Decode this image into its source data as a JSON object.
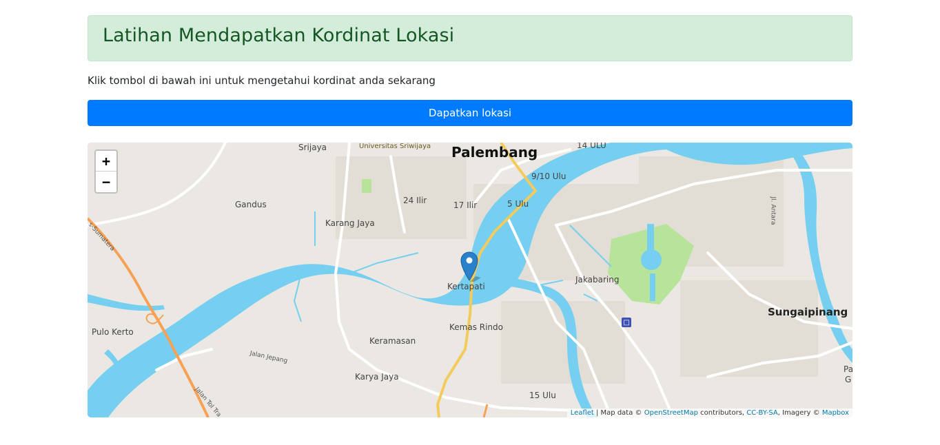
{
  "header": {
    "title": "Latihan Mendapatkan Kordinat Lokasi"
  },
  "intro_text": "Klik tombol di bawah ini untuk mengetahui kordinat anda sekarang",
  "locate_button": {
    "label": "Dapatkan lokasi"
  },
  "map": {
    "zoom_in": "+",
    "zoom_out": "−",
    "colors": {
      "water": "#76cff0",
      "land": "#ebe8e3",
      "park": "#b7e39b",
      "highway": "#f7a155",
      "main_road": "#f3cb5c",
      "marker": "#2a81cb"
    },
    "places": {
      "palembang": "Palembang",
      "srijaya": "Srijaya",
      "universitas": "Universitas Sriwijaya",
      "ulu14": "14 ULU",
      "ulu910": "9/10 Ulu",
      "ilir24": "24 Ilir",
      "ilir17": "17 Ilir",
      "ulu5": "5 Ulu",
      "gandus": "Gandus",
      "karang_jaya": "Karang Jaya",
      "kertapati": "Kertapati",
      "jakabaring": "Jakabaring",
      "sungaipinang": "Sungaipinang",
      "pulo_kerto": "Pulo Kerto",
      "keramasan": "Keramasan",
      "kemas_rindo": "Kemas Rindo",
      "karya_jaya": "Karya Jaya",
      "ulu15": "15 Ulu",
      "jalan_jepang": "Jalan Jepang",
      "jalan_tol": "Jalan Tol Tra",
      "sumatera": "s-Sumatera",
      "jl_antara": "Jl. Antara",
      "edge_pa": "Pa",
      "edge_g": "G"
    },
    "attribution": {
      "leaflet": "Leaflet",
      "map_data": "| Map data ©",
      "osm": "OpenStreetMap",
      "contributors": "contributors,",
      "license": "CC-BY-SA",
      "imagery": ", Imagery ©",
      "mapbox": "Mapbox"
    }
  }
}
